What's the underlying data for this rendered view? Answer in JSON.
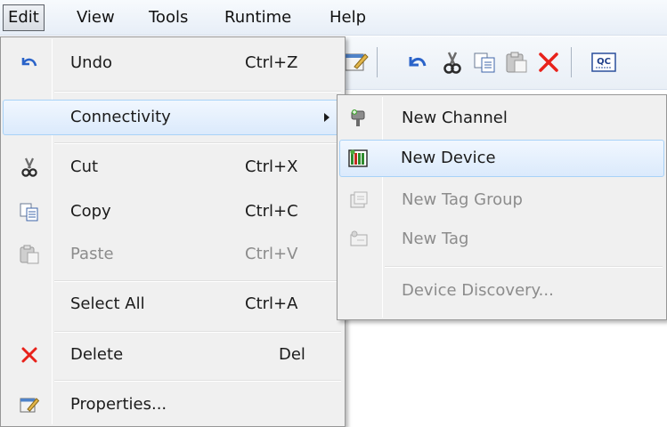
{
  "menubar": {
    "items": [
      {
        "label": "Edit"
      },
      {
        "label": "View"
      },
      {
        "label": "Tools"
      },
      {
        "label": "Runtime"
      },
      {
        "label": "Help"
      }
    ]
  },
  "edit_menu": {
    "undo": {
      "label": "Undo",
      "shortcut": "Ctrl+Z",
      "icon": "undo-icon"
    },
    "connectivity": {
      "label": "Connectivity"
    },
    "cut": {
      "label": "Cut",
      "shortcut": "Ctrl+X",
      "icon": "scissors-icon"
    },
    "copy": {
      "label": "Copy",
      "shortcut": "Ctrl+C",
      "icon": "copy-icon"
    },
    "paste": {
      "label": "Paste",
      "shortcut": "Ctrl+V",
      "icon": "paste-icon",
      "disabled": true
    },
    "select_all": {
      "label": "Select All",
      "shortcut": "Ctrl+A"
    },
    "delete": {
      "label": "Delete",
      "shortcut": "Del",
      "icon": "delete-x-icon"
    },
    "properties": {
      "label": "Properties...",
      "icon": "properties-icon"
    }
  },
  "connectivity_menu": {
    "new_channel": {
      "label": "New Channel",
      "icon": "new-channel-icon"
    },
    "new_device": {
      "label": "New Device",
      "icon": "new-device-icon"
    },
    "new_tag_group": {
      "label": "New Tag Group",
      "icon": "new-tag-group-icon",
      "disabled": true
    },
    "new_tag": {
      "label": "New Tag",
      "icon": "new-tag-icon",
      "disabled": true
    },
    "device_discovery": {
      "label": "Device Discovery...",
      "disabled": true
    }
  },
  "toolbar": {
    "icons": [
      "properties-icon",
      "undo-icon",
      "cut-icon",
      "copy-icon",
      "paste-icon",
      "delete-icon",
      "quick-client-icon"
    ],
    "quick_client_text": "QC"
  },
  "colors": {
    "menu_bg": "#f0f0f0",
    "highlight_border": "#a8d2f7",
    "highlight_bg": "#dbeafc",
    "delete_red": "#e8221b",
    "undo_blue": "#2a63c9"
  }
}
